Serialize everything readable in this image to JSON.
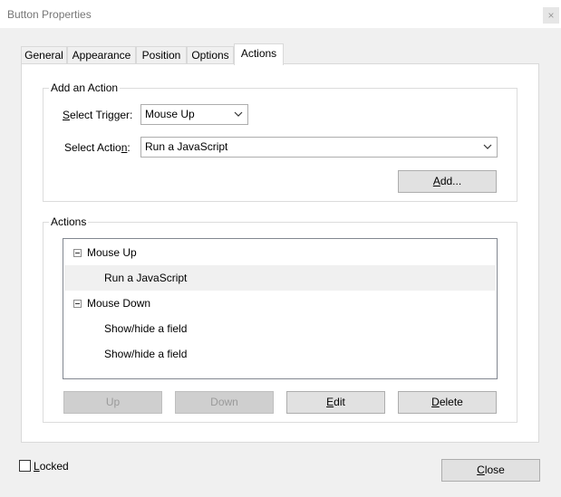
{
  "window": {
    "title": "Button Properties",
    "close_glyph": "×"
  },
  "tabs": [
    {
      "label": "General"
    },
    {
      "label": "Appearance"
    },
    {
      "label": "Position"
    },
    {
      "label": "Options"
    },
    {
      "label": "Actions",
      "active": true
    }
  ],
  "add_action": {
    "legend": "Add an Action",
    "trigger_label_underlined": "S",
    "trigger_label_rest": "elect Trigger:",
    "trigger_value": "Mouse Up",
    "action_label_pre": "Select Actio",
    "action_label_underlined": "n",
    "action_label_post": ":",
    "action_value": "Run a JavaScript",
    "add_button_underlined": "A",
    "add_button_rest": "dd..."
  },
  "actions": {
    "legend": "Actions",
    "tree": [
      {
        "label": "Mouse Up",
        "level": 0,
        "expanded": true
      },
      {
        "label": "Run a JavaScript",
        "level": 1,
        "selected": true
      },
      {
        "label": "Mouse Down",
        "level": 0,
        "expanded": true
      },
      {
        "label": "Show/hide a field",
        "level": 1
      },
      {
        "label": "Show/hide a field",
        "level": 1
      }
    ],
    "buttons": {
      "up": "Up",
      "down": "Down",
      "edit_underlined": "E",
      "edit_rest": "dit",
      "delete_underlined": "D",
      "delete_rest": "elete"
    }
  },
  "footer": {
    "locked_underlined": "L",
    "locked_rest": "ocked",
    "locked_checked": false,
    "close_underlined": "C",
    "close_rest": "lose"
  }
}
